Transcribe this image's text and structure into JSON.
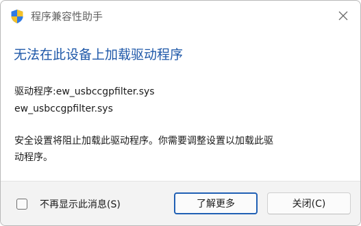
{
  "window": {
    "title": "程序兼容性助手",
    "close_icon": "close-icon"
  },
  "dialog": {
    "heading": "无法在此设备上加载驱动程序",
    "driver_line": "驱动程序:ew_usbccgpfilter.sys",
    "file_line": "ew_usbccgpfilter.sys",
    "message_line1": "安全设置将阻止加载此驱动程序。你需要调整设置以加载此驱",
    "message_line2": "动程序。"
  },
  "footer": {
    "checkbox_label": "不再显示此消息(S)",
    "checkbox_checked": false,
    "learn_more_label": "了解更多",
    "close_label": "关闭(C)"
  },
  "colors": {
    "heading": "#1d57a8",
    "primary_border": "#1f5fb4",
    "footer_bg": "#f3f3f3"
  }
}
